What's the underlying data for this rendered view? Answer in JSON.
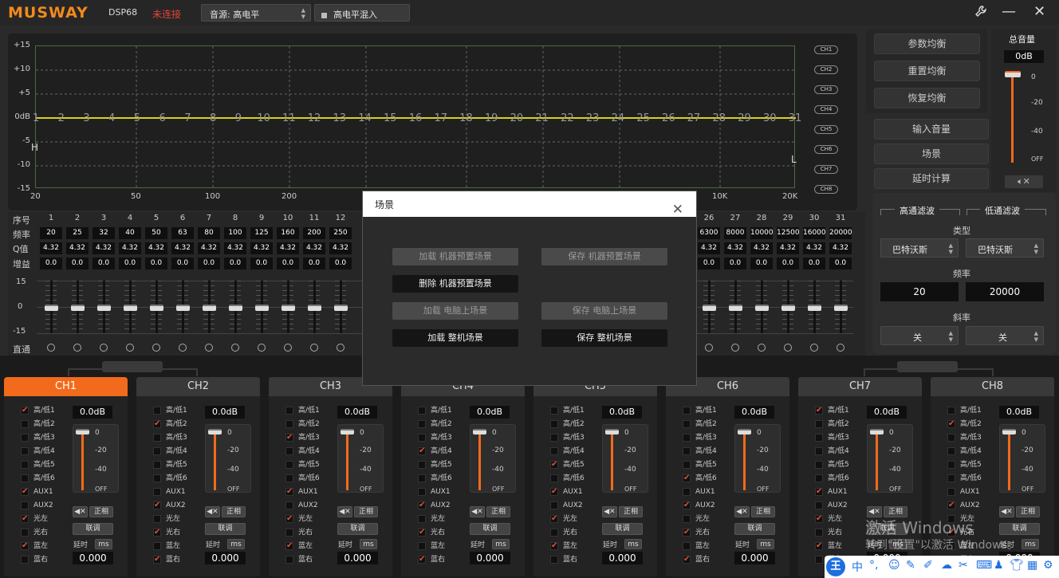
{
  "header": {
    "logo": "MUSWAY",
    "model": "DSP68",
    "connection_status": "未连接",
    "source_label": "音源: 高电平",
    "mix_label": "高电平混入",
    "icons": [
      "wrench-icon",
      "minimize-icon",
      "close-icon"
    ]
  },
  "graph": {
    "y_labels": [
      "+15",
      "+10",
      "+5",
      "0dB",
      "-5",
      "-10",
      "-15"
    ],
    "x_labels": [
      "20",
      "50",
      "100",
      "200",
      "10K",
      "20K"
    ],
    "band_numbers": [
      "1",
      "2",
      "3",
      "4",
      "5",
      "6",
      "7",
      "8",
      "9",
      "10",
      "11",
      "12",
      "13",
      "14",
      "15",
      "16",
      "17",
      "18",
      "19",
      "20",
      "21",
      "22",
      "23",
      "24",
      "25",
      "26",
      "27",
      "28",
      "29",
      "30",
      "31"
    ],
    "hp_marker": "H",
    "lp_marker": "L",
    "ch_buttons": [
      "CH1",
      "CH2",
      "CH3",
      "CH4",
      "CH5",
      "CH6",
      "CH7",
      "CH8"
    ],
    "curve_color": "#d8d21a"
  },
  "right_buttons": {
    "param_eq": "参数均衡",
    "reset_eq": "重置均衡",
    "restore_eq": "恢复均衡",
    "input_volume": "输入音量",
    "scene": "场景",
    "delay_calc": "延时计算"
  },
  "master": {
    "title": "总音量",
    "value": "0dB",
    "scale": [
      "0",
      "-20",
      "-40",
      "OFF"
    ]
  },
  "filter": {
    "hp_title": "高通滤波",
    "lp_title": "低通滤波",
    "type_label": "类型",
    "hp_type": "巴特沃斯",
    "lp_type": "巴特沃斯",
    "freq_label": "频率",
    "hp_freq": "20",
    "lp_freq": "20000",
    "slope_label": "斜率",
    "hp_slope": "关",
    "lp_slope": "关"
  },
  "eq_table": {
    "row_labels": {
      "index": "序号",
      "freq": "频率",
      "q": "Q值",
      "gain": "增益",
      "bypass": "直通"
    },
    "scale": [
      "15",
      "0",
      "-15"
    ],
    "left_cols": [
      {
        "n": "1",
        "f": "20",
        "q": "4.32",
        "g": "0.0"
      },
      {
        "n": "2",
        "f": "25",
        "q": "4.32",
        "g": "0.0"
      },
      {
        "n": "3",
        "f": "32",
        "q": "4.32",
        "g": "0.0"
      },
      {
        "n": "4",
        "f": "40",
        "q": "4.32",
        "g": "0.0"
      },
      {
        "n": "5",
        "f": "50",
        "q": "4.32",
        "g": "0.0"
      },
      {
        "n": "6",
        "f": "63",
        "q": "4.32",
        "g": "0.0"
      },
      {
        "n": "7",
        "f": "80",
        "q": "4.32",
        "g": "0.0"
      },
      {
        "n": "8",
        "f": "100",
        "q": "4.32",
        "g": "0.0"
      },
      {
        "n": "9",
        "f": "125",
        "q": "4.32",
        "g": "0.0"
      },
      {
        "n": "10",
        "f": "160",
        "q": "4.32",
        "g": "0.0"
      },
      {
        "n": "11",
        "f": "200",
        "q": "4.32",
        "g": "0.0"
      },
      {
        "n": "12",
        "f": "250",
        "q": "4.32",
        "g": "0.0"
      }
    ],
    "right_cols": [
      {
        "n": "26",
        "f": "6300",
        "q": "4.32",
        "g": "0.0"
      },
      {
        "n": "27",
        "f": "8000",
        "q": "4.32",
        "g": "0.0"
      },
      {
        "n": "28",
        "f": "10000",
        "q": "4.32",
        "g": "0.0"
      },
      {
        "n": "29",
        "f": "12500",
        "q": "4.32",
        "g": "0.0"
      },
      {
        "n": "30",
        "f": "16000",
        "q": "4.32",
        "g": "0.0"
      },
      {
        "n": "31",
        "f": "20000",
        "q": "4.32",
        "g": "0.0"
      }
    ]
  },
  "channels": {
    "input_labels": [
      "高/低1",
      "高/低2",
      "高/低3",
      "高/低4",
      "高/低5",
      "高/低6",
      "AUX1",
      "AUX2",
      "光左",
      "光右",
      "蓝左",
      "蓝右"
    ],
    "phase_label": "正相",
    "link_label": "联调",
    "delay_label": "延时",
    "delay_unit": "ms",
    "scale": [
      "0",
      "-20",
      "-40",
      "OFF"
    ],
    "list": [
      {
        "name": "CH1",
        "gain": "0.0dB",
        "delay": "0.000",
        "checks": [
          1,
          0,
          0,
          0,
          0,
          0,
          1,
          0,
          1,
          0,
          1,
          0
        ]
      },
      {
        "name": "CH2",
        "gain": "0.0dB",
        "delay": "0.000",
        "checks": [
          0,
          1,
          0,
          0,
          0,
          0,
          0,
          1,
          0,
          1,
          0,
          1
        ]
      },
      {
        "name": "CH3",
        "gain": "0.0dB",
        "delay": "0.000",
        "checks": [
          0,
          0,
          1,
          0,
          0,
          0,
          1,
          0,
          1,
          0,
          1,
          0
        ]
      },
      {
        "name": "CH4",
        "gain": "0.0dB",
        "delay": "0.000",
        "checks": [
          0,
          0,
          0,
          1,
          0,
          0,
          0,
          1,
          0,
          1,
          0,
          1
        ]
      },
      {
        "name": "CH5",
        "gain": "0.0dB",
        "delay": "0.000",
        "checks": [
          0,
          0,
          0,
          0,
          1,
          0,
          1,
          0,
          1,
          0,
          1,
          0
        ]
      },
      {
        "name": "CH6",
        "gain": "0.0dB",
        "delay": "0.000",
        "checks": [
          0,
          0,
          0,
          0,
          0,
          1,
          0,
          1,
          0,
          1,
          0,
          1
        ]
      },
      {
        "name": "CH7",
        "gain": "0.0dB",
        "delay": "0.000",
        "checks": [
          1,
          0,
          0,
          0,
          0,
          0,
          1,
          0,
          1,
          0,
          1,
          0
        ]
      },
      {
        "name": "CH8",
        "gain": "0.0dB",
        "delay": "0.000",
        "checks": [
          0,
          1,
          0,
          0,
          0,
          0,
          0,
          1,
          0,
          1,
          0,
          1
        ]
      }
    ]
  },
  "scene_dialog": {
    "title": "场景",
    "load_machine": "加载 机器预置场景",
    "save_machine": "保存 机器预置场景",
    "delete_machine": "删除 机器预置场景",
    "load_pc": "加载 电脑上场景",
    "save_pc": "保存 电脑上场景",
    "load_all": "加载 整机场景",
    "save_all": "保存 整机场景"
  },
  "watermark": {
    "line1": "激活 Windows",
    "line2": "转到\"设置\"以激活 Windows。"
  },
  "ime": {
    "brand": "王",
    "lang": "中"
  }
}
